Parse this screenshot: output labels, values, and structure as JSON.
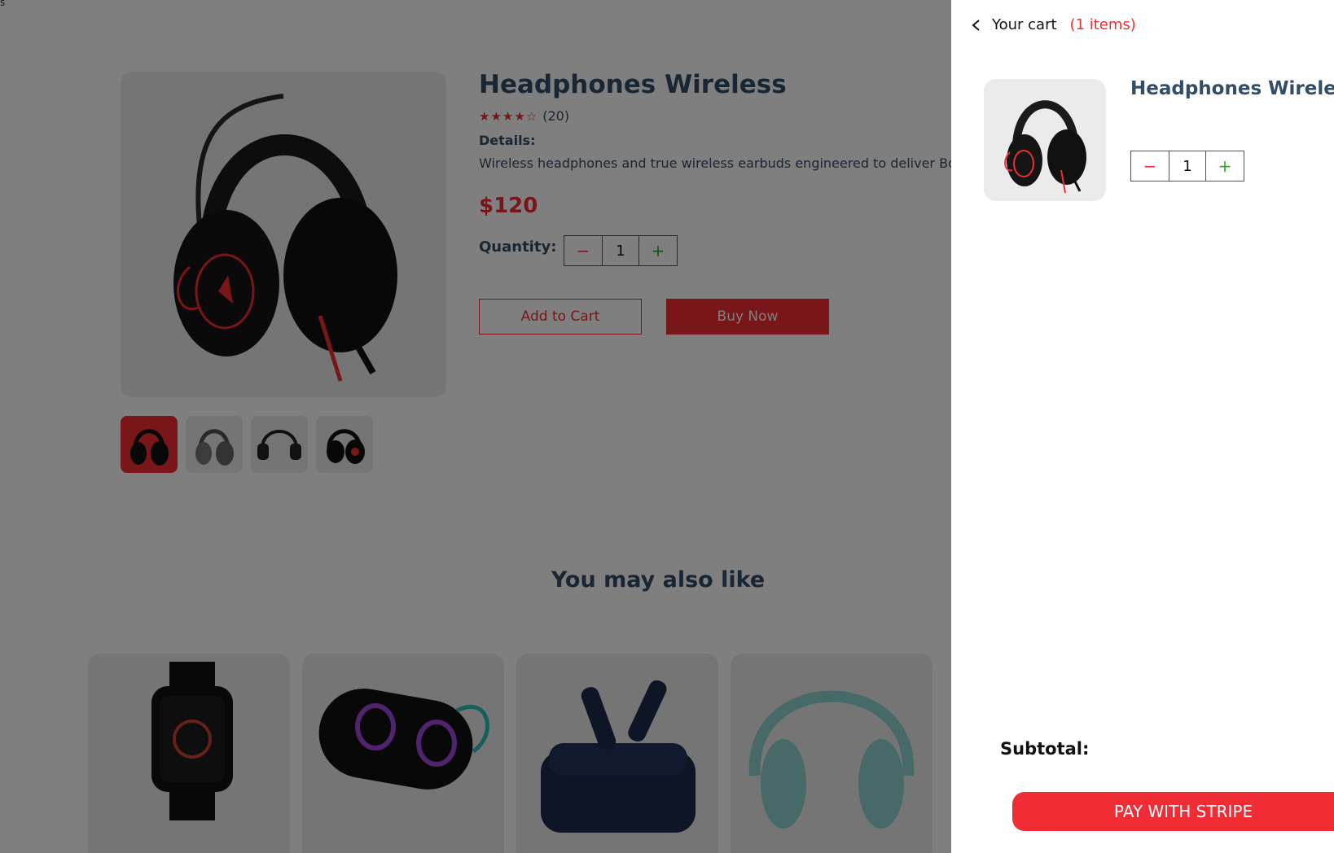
{
  "page": {
    "corner_text": "s",
    "product": {
      "title": "Headphones Wireless",
      "stars": "★★★★☆",
      "rating_count": "(20)",
      "details_label": "Details:",
      "details_text": "Wireless headphones and true wireless earbuds engineered to deliver Bose accla",
      "price": "$120",
      "quantity_label": "Quantity:",
      "quantity": {
        "minus": "−",
        "value": "1",
        "plus": "+"
      },
      "add_to_cart_label": "Add to Cart",
      "buy_now_label": "Buy Now"
    },
    "also_like_heading": "You may also like"
  },
  "cart": {
    "title": "Your cart",
    "count_label": "(1 items)",
    "items": [
      {
        "name": "Headphones Wireless",
        "quantity": {
          "minus": "−",
          "value": "1",
          "plus": "+"
        }
      }
    ],
    "subtotal_label": "Subtotal:",
    "pay_button_label": "PAY WITH STRIPE"
  },
  "colors": {
    "accent": "#f02d34",
    "heading": "#324d67",
    "plus": "#31a831"
  }
}
